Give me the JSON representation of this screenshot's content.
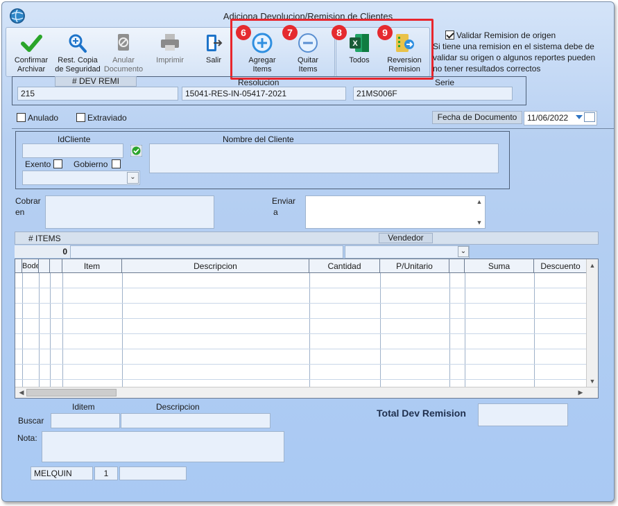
{
  "window": {
    "title": "Adiciona Devolucion/Remision de Clientes"
  },
  "toolbar": {
    "confirm": {
      "label1": "Confirmar",
      "label2": "Archivar"
    },
    "backup": {
      "label1": "Rest. Copia",
      "label2": "de Seguridad"
    },
    "cancel_doc": {
      "label1": "Anular",
      "label2": "Documento"
    },
    "print": {
      "label1": "Imprimir"
    },
    "exit": {
      "label1": "Salir"
    },
    "add_items": {
      "label1": "Agregar",
      "label2": "Items",
      "badge": "6"
    },
    "remove_items": {
      "label1": "Quitar",
      "label2": "Items",
      "badge": "7"
    },
    "all": {
      "label1": "Todos",
      "badge": "8"
    },
    "reversion": {
      "label1": "Reversion",
      "label2": "Remision",
      "badge": "9"
    }
  },
  "validate": {
    "label": "Validar Remision de origen",
    "checked": true,
    "note1": "Si tiene una remision en el sistema debe de",
    "note2": "validar su origen o algunos reportes pueden",
    "note3": "no tener resultados correctos"
  },
  "header": {
    "dev_remi_label": "# DEV REMI",
    "dev_remi_value": "215",
    "resolucion_label": "Resolucion",
    "resolucion_value": "15041-RES-IN-05417-2021",
    "serie_label": "Serie",
    "serie_value": "21MS006F"
  },
  "flags": {
    "anulado": "Anulado",
    "extraviado": "Extraviado",
    "fecha_label": "Fecha de  Documento",
    "fecha_value": "11/06/2022"
  },
  "cliente": {
    "id_label": "IdCliente",
    "nombre_label": "Nombre del Cliente",
    "exento": "Exento",
    "gobierno": "Gobierno"
  },
  "cobrar": {
    "label1": "Cobrar",
    "label2": "en"
  },
  "enviar": {
    "label1": "Enviar",
    "label2": "a"
  },
  "items_bar": {
    "items_label": "# ITEMS",
    "items_count": "0",
    "vendedor_label": "Vendedor"
  },
  "grid": {
    "columns": [
      "Bodega",
      "",
      "Item",
      "Descripcion",
      "Cantidad",
      "P/Unitario",
      "",
      "Suma",
      "Descuento"
    ]
  },
  "search": {
    "iditem_label": "Iditem",
    "descripcion_label": "Descripcion",
    "buscar_label": "Buscar",
    "nota_label": "Nota:"
  },
  "total": {
    "label": "Total Dev Remision"
  },
  "footer": {
    "user": "MELQUIN",
    "station": "1"
  },
  "icons": {
    "confirm": "checkmark-icon",
    "backup": "magnify-plus-icon",
    "cancel_doc": "cancel-document-icon",
    "print": "printer-icon",
    "exit": "exit-door-icon",
    "add": "plus-circle-icon",
    "remove": "minus-circle-icon",
    "excel": "excel-icon",
    "reversion": "reversion-icon"
  },
  "colors": {
    "badge": "#e52a2f",
    "highlight": "#e8262d",
    "accent": "#2f8fe0"
  }
}
